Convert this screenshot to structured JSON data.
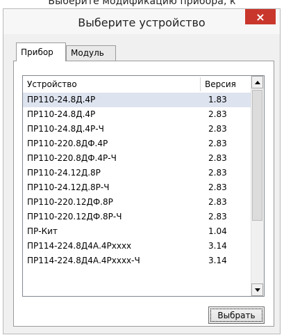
{
  "background_text": "Выберите модификацию прибора, к",
  "dialog": {
    "title": "Выберите устройство",
    "close_label": "×"
  },
  "tabs": [
    {
      "label": "Прибор",
      "active": true
    },
    {
      "label": "Модуль",
      "active": false
    }
  ],
  "table": {
    "columns": [
      "Устройство",
      "Версия"
    ],
    "rows": [
      {
        "device": "ПР110-24.8Д.4Р",
        "version": "1.83",
        "selected": true
      },
      {
        "device": "ПР110-24.8Д.4Р",
        "version": "2.83"
      },
      {
        "device": "ПР110-24.8Д.4Р-Ч",
        "version": "2.83"
      },
      {
        "device": "ПР110-220.8ДФ.4Р",
        "version": "2.83"
      },
      {
        "device": "ПР110-220.8ДФ.4Р-Ч",
        "version": "2.83"
      },
      {
        "device": "ПР110-24.12Д.8Р",
        "version": "2.83"
      },
      {
        "device": "ПР110-24.12Д.8Р-Ч",
        "version": "2.83"
      },
      {
        "device": "ПР110-220.12ДФ.8Р",
        "version": "2.83"
      },
      {
        "device": "ПР110-220.12ДФ.8Р-Ч",
        "version": "2.83"
      },
      {
        "device": "ПР-Кит",
        "version": "1.04"
      },
      {
        "device": "ПР114-224.8Д4А.4Рхххх",
        "version": "3.14"
      },
      {
        "device": "ПР114-224.8Д4А.4Рхххх-Ч",
        "version": "3.14"
      }
    ]
  },
  "select_button_label": "Выбрать"
}
